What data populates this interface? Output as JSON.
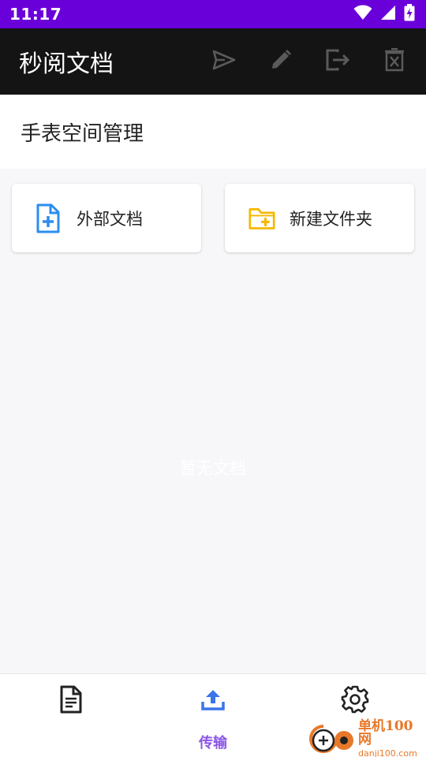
{
  "status_bar": {
    "time": "11:17",
    "icons": [
      "wifi-icon",
      "signal-icon",
      "battery-charging-icon"
    ]
  },
  "app_bar": {
    "title": "秒阅文档",
    "actions": [
      "send-icon",
      "edit-icon",
      "exit-icon",
      "delete-icon"
    ]
  },
  "section": {
    "title": "手表空间管理"
  },
  "cards": {
    "external": {
      "label": "外部文档",
      "icon": "file-plus-icon",
      "color": "#2b8ef0"
    },
    "new_folder": {
      "label": "新建文件夹",
      "icon": "folder-plus-icon",
      "color": "#f5b800"
    }
  },
  "empty_state": {
    "text": "暂无文档"
  },
  "bottom_nav": {
    "items": [
      {
        "name": "docs",
        "label": "",
        "icon": "document-icon",
        "active": false
      },
      {
        "name": "transfer",
        "label": "传输",
        "icon": "upload-icon",
        "active": true
      },
      {
        "name": "settings",
        "label": "",
        "icon": "gear-icon",
        "active": false
      }
    ],
    "active_color": "#8a55e6",
    "upload_color": "#3a74e8"
  },
  "watermark": {
    "title": "单机100网",
    "url": "danji100.com"
  },
  "colors": {
    "status_bar": "#6a00d9",
    "app_bar": "#141414",
    "background": "#f7f7f9"
  }
}
